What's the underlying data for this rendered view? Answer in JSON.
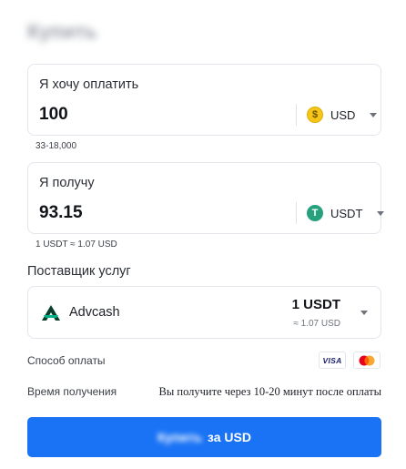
{
  "page": {
    "title": "Купить"
  },
  "pay": {
    "label": "Я хочу оплатить",
    "amount": "100",
    "currency": "USD",
    "currency_icon": "dollar-coin-icon",
    "limits": "33-18,000"
  },
  "receive": {
    "label": "Я получу",
    "amount": "93.15",
    "currency": "USDT",
    "currency_icon": "tether-icon",
    "rate": "1 USDT ≈ 1.07 USD"
  },
  "provider": {
    "section_label": "Поставщик услуг",
    "name": "Advcash",
    "amount": "1 USDT",
    "sub": "≈ 1.07 USD"
  },
  "payment_method": {
    "label": "Способ оплаты",
    "visa": "VISA",
    "icons": [
      "visa-icon",
      "mastercard-icon"
    ]
  },
  "receipt_time": {
    "label": "Время получения",
    "value": "Вы получите через 10-20 минут после оплаты"
  },
  "buy_button": {
    "prefix": "Купить",
    "suffix": "за USD"
  },
  "colors": {
    "accent": "#1a73f5",
    "usd_coin": "#f5c518",
    "usdt_coin": "#27a17c",
    "mastercard_red": "#eb001b",
    "mastercard_orange": "#f79e1b"
  }
}
